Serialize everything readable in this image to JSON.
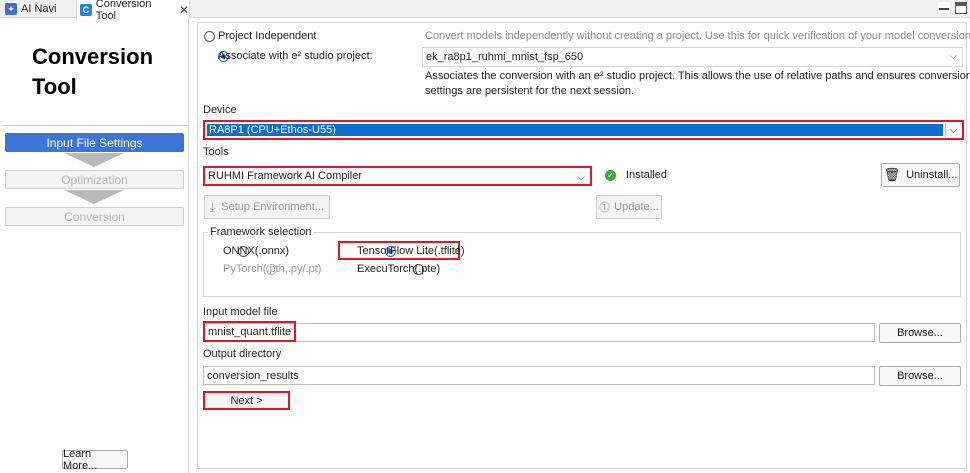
{
  "tabs": [
    {
      "label": "AI Navi",
      "icon": "ai-navi-icon"
    },
    {
      "label": "Conversion Tool",
      "icon": "conversion-tool-icon",
      "active": true
    }
  ],
  "left": {
    "title_line1": "Conversion",
    "title_line2": "Tool",
    "steps": [
      {
        "label": "Input File Settings",
        "state": "active"
      },
      {
        "label": "Optimization",
        "state": "disabled"
      },
      {
        "label": "Conversion",
        "state": "disabled"
      }
    ],
    "learn_more": "Learn More..."
  },
  "project": {
    "independent_label": "Project Independent",
    "independent_desc": "Convert models independently without creating a project. Use this for quick verification of your model conversion.",
    "associate_label": "Associate with e² studio project:",
    "associate_value": "ek_ra8p1_ruhmi_mnist_fsp_650",
    "associate_desc_line1": "Associates the conversion with an e² studio project. This allows the use of relative paths and ensures conversion",
    "associate_desc_line2": "settings are persistent for the next session.",
    "selected": "associate"
  },
  "device": {
    "label": "Device",
    "value": "RA8P1 (CPU+Ethos-U55)"
  },
  "tools": {
    "label": "Tools",
    "value": "RUHMI Framework AI Compiler",
    "status": "Installed",
    "uninstall": "Uninstall...",
    "setup_env": "Setup Environment...",
    "update": "Update..."
  },
  "framework": {
    "title": "Framework selection",
    "options": [
      {
        "label": "ONNX(.onnx)",
        "state": "unchecked"
      },
      {
        "label": "TensorFlow Lite(.tflite)",
        "state": "checked"
      },
      {
        "label": "PyTorch(.pth,.py/.pt)",
        "state": "disabled"
      },
      {
        "label": "ExecuTorch(.pte)",
        "state": "unchecked"
      }
    ]
  },
  "input_model": {
    "label": "Input model file",
    "value": "mnist_quant.tflite",
    "browse": "Browse..."
  },
  "output_dir": {
    "label": "Output directory",
    "value": "conversion_results",
    "browse": "Browse..."
  },
  "next": "Next >",
  "colors": {
    "accent": "#3d74d8",
    "selection": "#0f6fd0",
    "highlight": "#e0172b",
    "installed": "#3fa83f"
  }
}
